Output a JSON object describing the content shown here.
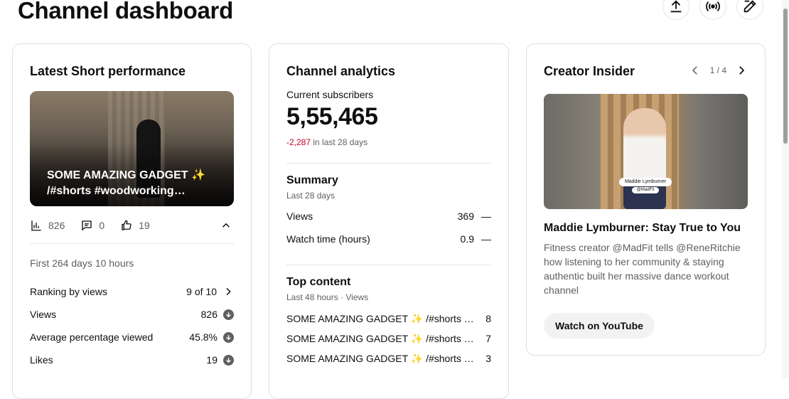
{
  "page": {
    "title": "Channel dashboard"
  },
  "header_actions": [
    {
      "icon": "upload-icon"
    },
    {
      "icon": "live-icon"
    },
    {
      "icon": "edit-icon"
    }
  ],
  "short_card": {
    "title": "Latest Short performance",
    "thumbnail_lines": [
      "SOME AMAZING GADGET ✨",
      "/#shorts #woodworking…"
    ],
    "stats": {
      "views": "826",
      "comments": "0",
      "likes": "19"
    },
    "first_period": "First 264 days 10 hours",
    "metrics": [
      {
        "label": "Ranking by views",
        "value": "9 of 10"
      },
      {
        "label": "Views",
        "value": "826"
      },
      {
        "label": "Average percentage viewed",
        "value": "45.8%"
      },
      {
        "label": "Likes",
        "value": "19"
      }
    ]
  },
  "analytics_card": {
    "title": "Channel analytics",
    "current_subscribers_label": "Current subscribers",
    "subscribers": "5,55,465",
    "change_value": "-2,287",
    "change_suffix": " in last 28 days",
    "summary_title": "Summary",
    "summary_period": "Last 28 days",
    "summary_rows": [
      {
        "label": "Views",
        "value": "369",
        "trend": "—"
      },
      {
        "label": "Watch time (hours)",
        "value": "0.9",
        "trend": "—"
      }
    ],
    "top_title": "Top content",
    "top_period": "Last 48 hours · Views",
    "top_rows": [
      {
        "title": "SOME AMAZING GADGET ✨ /#shorts #woodworking",
        "value": "8"
      },
      {
        "title": "SOME AMAZING GADGET ✨ /#shorts #woodworking",
        "value": "7"
      },
      {
        "title": "SOME AMAZING GADGET ✨ /#shorts #woodworking",
        "value": "3"
      }
    ]
  },
  "insider_card": {
    "title": "Creator Insider",
    "pager": "1 / 4",
    "thumbnail_tag": "Maddie Lymburner",
    "thumbnail_tag2": "@MadFit",
    "video_title": "Maddie Lymburner: Stay True to You",
    "video_desc": "Fitness creator @MadFit tells @ReneRitchie how listening to her community & staying authentic built her massive dance workout channel",
    "button": "Watch on YouTube"
  }
}
